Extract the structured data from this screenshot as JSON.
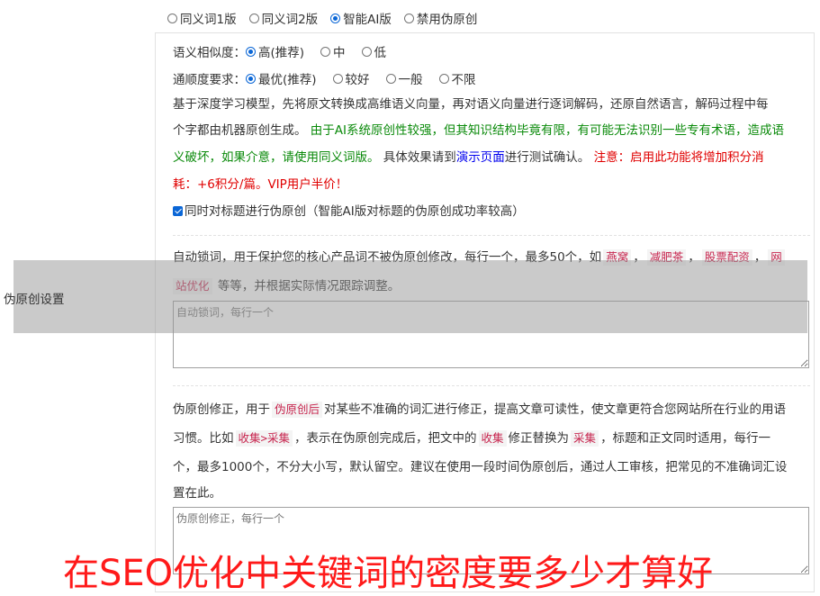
{
  "modes": {
    "options": [
      "同义词1版",
      "同义词2版",
      "智能AI版",
      "禁用伪原创"
    ],
    "selected": 2
  },
  "similarity": {
    "label": "语义相似度：",
    "options": [
      "高(推荐)",
      "中",
      "低"
    ],
    "selected": 0
  },
  "fluency": {
    "label": "通顺度要求：",
    "options": [
      "最优(推荐)",
      "较好",
      "一般",
      "不限"
    ],
    "selected": 0
  },
  "description": {
    "part1": "基于深度学习模型，先将原文转换成高维语义向量，再对语义向量进行逐词解码，还原自然语言，解码过程中每",
    "part2a": "个字都由机器原创生成。 ",
    "green1": "由于AI系统原创性较强，但其知识结构毕竟有限，有可能无法识别一些专有术语，造成语",
    "green2": "义破坏，如果介意，请使用同义词版。",
    "part3a": " 具体效果请到",
    "demo_link": "演示页面",
    "part3b": "进行测试确认。 ",
    "red1": "注意：启用此功能将增加积分消",
    "red2": "耗：+6积分/篇。VIP用户半价！"
  },
  "title_checkbox": {
    "label": "同时对标题进行伪原创（智能AI版对标题的伪原创成功率较高）",
    "checked": true
  },
  "section_label": "伪原创设置",
  "lock_words": {
    "text_a": "自动锁词，用于保护您的核心产品词不被伪原创修改，每行一个，最多50个，如",
    "examples": [
      "燕窝",
      "减肥茶",
      "股票配资",
      "网",
      "站优化"
    ],
    "text_b": "等等，并根据实际情况跟踪调整。",
    "placeholder": "自动锁词，每行一个"
  },
  "correction": {
    "text_a": "伪原创修正，用于",
    "tag1": "伪原创后",
    "text_b": "对某些不准确的词汇进行修正，提高文章可读性，使文章更符合您网站所在行业的用语",
    "text_c": "习惯。比如",
    "tag2": "收集>采集",
    "text_d": "，表示在伪原创完成后，把文中的",
    "tag3": "收集",
    "text_e": "修正替换为",
    "tag4": "采集",
    "text_f": "，标题和正文同时适用，每行一",
    "text_g": "个，最多1000个，不分大小写，默认留空。建议在使用一段时间伪原创后，通过人工审核，把常见的不准确词汇设",
    "text_h": "置在此。",
    "placeholder": "伪原创修正，每行一个"
  },
  "watermark": "在SEO优化中关键词的密度要多少才算好",
  "colors": {
    "accent": "#0a66d6",
    "green": "#0a8a0a",
    "red": "#e00000",
    "link": "#0000ee",
    "tag": "#c7254e"
  }
}
